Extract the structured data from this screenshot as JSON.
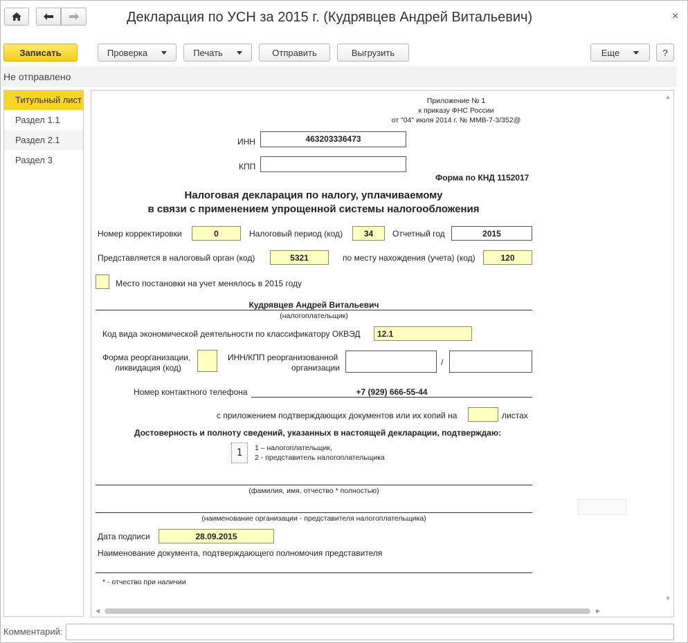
{
  "window": {
    "title": "Декларация по УСН за 2015 г. (Кудрявцев Андрей Витальевич)",
    "close_glyph": "×"
  },
  "nav": {
    "home_icon": "home-icon",
    "back_icon": "arrow-left-icon",
    "forward_icon": "arrow-right-icon"
  },
  "toolbar": {
    "save": "Записать",
    "check": "Проверка",
    "print": "Печать",
    "send": "Отправить",
    "upload": "Выгрузить",
    "more": "Еще",
    "help": "?"
  },
  "status": {
    "text": "Не отправлено"
  },
  "sidebar": {
    "items": [
      {
        "label": "Титульный лист"
      },
      {
        "label": "Раздел 1.1"
      },
      {
        "label": "Раздел 2.1"
      },
      {
        "label": "Раздел 3"
      }
    ]
  },
  "form": {
    "appendix": [
      "Приложение № 1",
      "к приказу ФНС России",
      "от \"04\" июля 2014 г. № ММВ-7-3/352@"
    ],
    "inn_label": "ИНН",
    "inn_value": "463203336473",
    "kpp_label": "КПП",
    "kpp_value": "",
    "knd": "Форма по КНД 1152017",
    "heading_line1": "Налоговая декларация по налогу, уплачиваемому",
    "heading_line2": "в связи с применением упрощенной системы налогообложения",
    "correction_label": "Номер корректировки",
    "correction_value": "0",
    "period_label": "Налоговый период (код)",
    "period_value": "34",
    "year_label": "Отчетный год",
    "year_value": "2015",
    "authority_label": "Представляется в налоговый орган (код)",
    "authority_value": "5321",
    "location_label": "по месту нахождения (учета) (код)",
    "location_value": "120",
    "registration_changed_label": "Место постановки на учет менялось в 2015 году",
    "taxpayer_name": "Кудрявцев Андрей Витальевич",
    "taxpayer_caption": "(налогоплательщик)",
    "okved_label": "Код вида экономической деятельности по классификатору ОКВЭД",
    "okved_value": "12.1",
    "reorg_form_label_1": "Форма реорганизации,",
    "reorg_form_label_2": "ликвидация (код)",
    "reorg_inn_label_1": "ИНН/КПП реорганизованной",
    "reorg_inn_label_2": "организации",
    "slash": "/",
    "phone_label": "Номер контактного телефона",
    "phone_value": "+7 (929) 666-55-44",
    "attachments_label": "с приложением подтверждающих документов или их копий на",
    "sheets_label": "листах",
    "confirm_heading": "Достоверность и полноту сведений, указанных в настоящей декларации, подтверждаю:",
    "signer_code": "1",
    "signer_option_1": "1 – налогоплательщик,",
    "signer_option_2": "2 - представитель налогоплательщика",
    "fio_caption": "(фамилия, имя, отчество * полностью)",
    "org_caption": "(наименование организации - представителя налогоплательщика)",
    "sign_date_label": "Дата подписи",
    "sign_date_value": "28.09.2015",
    "rep_doc_label": "Наименование документа, подтверждающего полномочия представителя",
    "footnote": "* - отчество при наличии"
  },
  "comment": {
    "label": "Комментарий:"
  }
}
